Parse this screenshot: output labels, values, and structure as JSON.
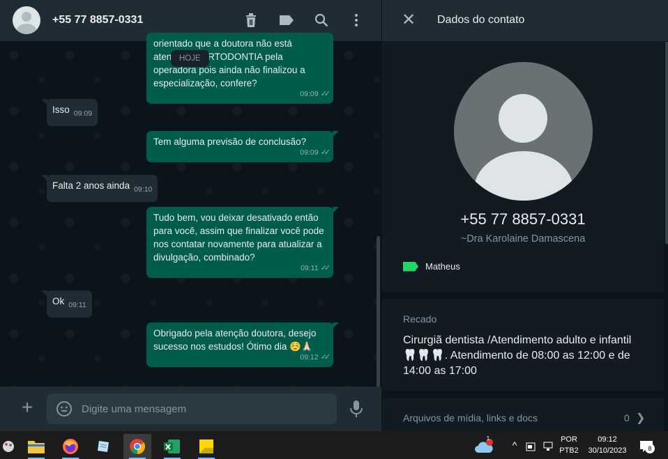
{
  "chat": {
    "contact_title": "+55 77 8857-0331",
    "date_badge": "HOJE",
    "messages": [
      {
        "dir": "out",
        "text": "orientado que a doutora não está atendendo ORTODONTIA pela operadora pois ainda não finalizou a especialização, confere?",
        "time": "09:09"
      },
      {
        "dir": "in",
        "text": "Isso",
        "time": "09:09"
      },
      {
        "dir": "out",
        "text": "Tem alguma previsão de conclusão?",
        "time": "09:09"
      },
      {
        "dir": "in",
        "text": "Falta 2 anos ainda",
        "time": "09:10"
      },
      {
        "dir": "out",
        "text": "Tudo bem, vou deixar desativado então para você, assim que finalizar você pode nos contatar novamente para atualizar a divulgação, combinado?",
        "time": "09:11"
      },
      {
        "dir": "in",
        "text": "Ok",
        "time": "09:11"
      },
      {
        "dir": "out",
        "text": "Obrigado pela atenção doutora, desejo sucesso nos estudos! Ótimo dia ☺️🙏🏻",
        "time": "09:12"
      }
    ],
    "input_placeholder": "Digite uma mensagem"
  },
  "contact_panel": {
    "title": "Dados do contato",
    "phone": "+55 77 8857-0331",
    "alias": "~Dra Karolaine Damascena",
    "label": "Matheus",
    "recado_label": "Recado",
    "recado_text": "Cirurgiã dentista /Atendimento adulto e infantil🦷🦷🦷. Atendimento de 08:00 as 12:00 e de 14:00 as 17:00",
    "media_label": "Arquivos de mídia, links e docs",
    "media_count": "0"
  },
  "taskbar": {
    "apps": [
      "paint-icon",
      "file-explorer-icon",
      "firefox-icon",
      "notepad-icon",
      "chrome-icon",
      "excel-icon",
      "sticky-notes-icon"
    ],
    "weather_badge": "1",
    "lang_line1": "POR",
    "lang_line2": "PTB2",
    "time": "09:12",
    "date": "30/10/2023",
    "notification_count": "8"
  },
  "colors": {
    "outgoing_bubble": "#005c4b",
    "incoming_bubble": "#202c33",
    "header": "#202c33",
    "label_tag": "#25d366"
  }
}
